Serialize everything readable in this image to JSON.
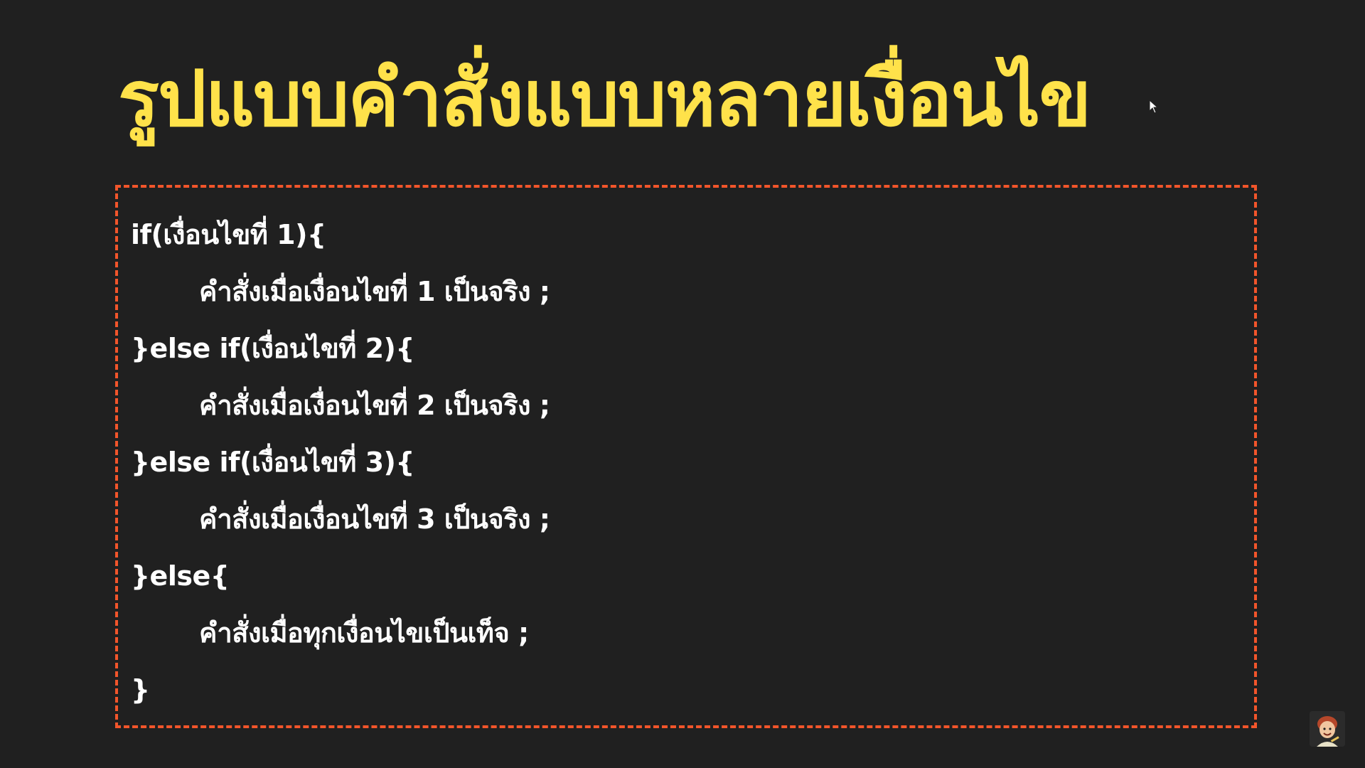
{
  "slide": {
    "title": "รูปแบบคำสั่งแบบหลายเงื่อนไข",
    "accent_color": "#ffe24a",
    "border_color": "#f2552b",
    "background_color": "#202020",
    "code_lines": [
      {
        "text": "if(เงื่อนไขที่ 1){",
        "indent": false
      },
      {
        "text": "คำสั่งเมื่อเงื่อนไขที่ 1 เป็นจริง ;",
        "indent": true
      },
      {
        "text": "}else if(เงื่อนไขที่ 2){",
        "indent": false
      },
      {
        "text": "คำสั่งเมื่อเงื่อนไขที่ 2 เป็นจริง ;",
        "indent": true
      },
      {
        "text": "}else if(เงื่อนไขที่ 3){",
        "indent": false
      },
      {
        "text": "คำสั่งเมื่อเงื่อนไขที่ 3 เป็นจริง ;",
        "indent": true
      },
      {
        "text": "}else{",
        "indent": false
      },
      {
        "text": "คำสั่งเมื่อทุกเงื่อนไขเป็นเท็จ ;",
        "indent": true
      },
      {
        "text": "}",
        "indent": false
      }
    ]
  },
  "icons": {
    "cursor": "mouse-pointer-icon",
    "avatar": "presenter-avatar-icon"
  }
}
